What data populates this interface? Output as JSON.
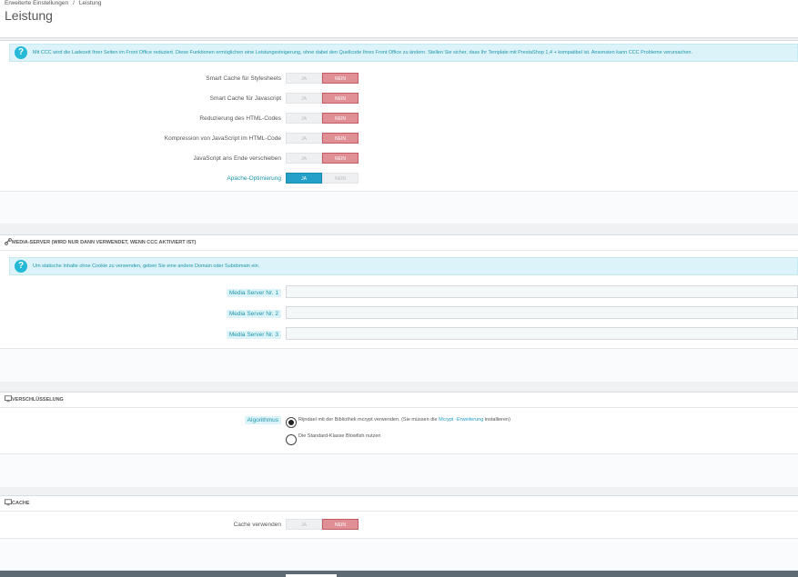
{
  "breadcrumb": {
    "parent": "Erweiterte Einstellungen",
    "separator": "/",
    "current": "Leistung"
  },
  "page": {
    "title": "Leistung"
  },
  "ccc": {
    "alert": "Mit CCC wird die Ladezeit Ihrer Seiten im Front Office reduziert. Diese Funktionen ermöglichen eine Leistungssteigerung, ohne dabei den Quellcode Ihres Front Office zu ändern. Stellen Sie sicher, dass Ihr Template mit PrestaShop 1,4 + kompatibel ist. Ansonsten kann CCC Probleme verursachen.",
    "alert_icon": "question-icon",
    "options": [
      {
        "label": "Smart Cache für Stylesheets",
        "yes": "JA",
        "no": "NEIN",
        "value": "no"
      },
      {
        "label": "Smart Cache für Javascript",
        "yes": "JA",
        "no": "NEIN",
        "value": "no"
      },
      {
        "label": "Reduzierung des HTML-Codes",
        "yes": "JA",
        "no": "NEIN",
        "value": "no"
      },
      {
        "label": "Kompression von JavaScript im HTML-Code",
        "yes": "JA",
        "no": "NEIN",
        "value": "no"
      },
      {
        "label": "JavaScript ans Ende verschieben",
        "yes": "JA",
        "no": "NEIN",
        "value": "no"
      },
      {
        "label": "Apache-Optimierung",
        "yes": "JA",
        "no": "NEIN",
        "value": "yes"
      }
    ]
  },
  "media": {
    "heading": "Media-Server (wird nur dann verwendet, wenn CCC aktiviert ist)",
    "heading_icon": "link-icon",
    "alert": "Um statische Inhalte ohne Cookie zu verwenden, geben Sie eine andere Domain oder Subdomain ein.",
    "fields": [
      {
        "label": "Media Server Nr. 1",
        "value": ""
      },
      {
        "label": "Media Server Nr. 2",
        "value": ""
      },
      {
        "label": "Media Server Nr. 3",
        "value": ""
      }
    ]
  },
  "encryption": {
    "heading": "Verschlüsselung",
    "heading_icon": "monitor-icon",
    "label": "Algorithmus",
    "option1_before": "Rijndael mit der Bibliothek mcrypt verwenden. (Sie müssen die",
    "option1_link": "Mcrypt -Erweiterung",
    "option1_after": "installieren)",
    "option2": "Die Standard-Klasse Blowfish nutzen",
    "selected": "rijndael"
  },
  "cache": {
    "heading": "Cache",
    "heading_icon": "monitor-icon",
    "label": "Cache verwenden",
    "yes": "JA",
    "no": "NEIN",
    "value": "no"
  },
  "colors": {
    "accent": "#25b9d7",
    "switch_no_active": "#e08f95",
    "switch_yes_active": "#25a1c9",
    "alert_bg": "#dcf4f9"
  }
}
